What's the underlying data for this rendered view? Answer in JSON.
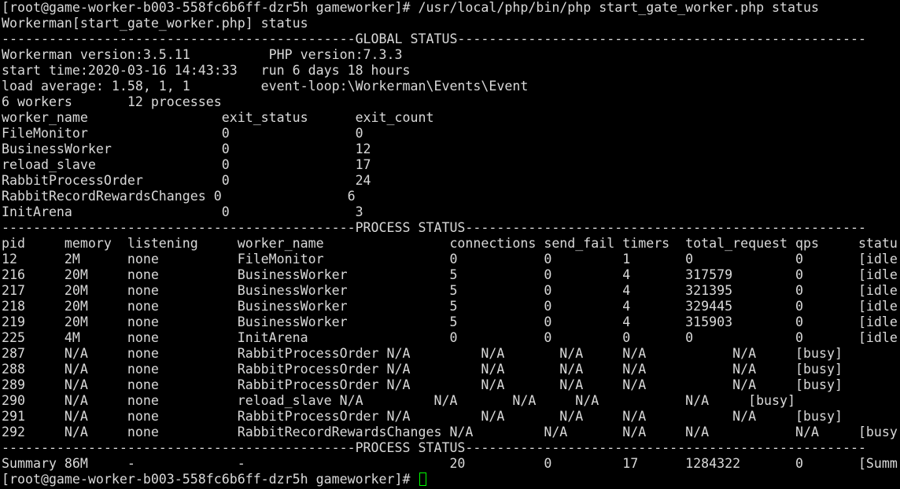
{
  "terminal": {
    "lines": [
      "[root@game-worker-b003-558fc6b6ff-dzr5h gameworker]# /usr/local/php/bin/php start_gate_worker.php status",
      "Workerman[start_gate_worker.php] status",
      "---------------------------------------------GLOBAL STATUS----------------------------------------------------",
      "Workerman version:3.5.11          PHP version:7.3.3",
      "start time:2020-03-16 14:43:33   run 6 days 18 hours",
      "load average: 1.58, 1, 1         event-loop:\\Workerman\\Events\\Event",
      "6 workers       12 processes",
      "worker_name                 exit_status      exit_count",
      "FileMonitor                 0                0",
      "BusinessWorker              0                12",
      "reload_slave                0                17",
      "RabbitProcessOrder          0                24",
      "RabbitRecordRewardsChanges 0                6",
      "InitArena                   0                3",
      "---------------------------------------------PROCESS STATUS---------------------------------------------------",
      "pid     memory  listening     worker_name                connections send_fail timers  total_request qps     status",
      "12      2M      none          FileMonitor                0           0         1       0             0       [idle]",
      "216     20M     none          BusinessWorker             5           0         4       317579        0       [idle]",
      "217     20M     none          BusinessWorker             5           0         4       321395        0       [idle]",
      "218     20M     none          BusinessWorker             5           0         4       329445        0       [idle]",
      "219     20M     none          BusinessWorker             5           0         4       315903        0       [idle]",
      "225     4M      none          InitArena                  0           0         0       0             0       [idle]",
      "287     N/A     none          RabbitProcessOrder N/A         N/A       N/A     N/A           N/A     [busy]",
      "288     N/A     none          RabbitProcessOrder N/A         N/A       N/A     N/A           N/A     [busy]",
      "289     N/A     none          RabbitProcessOrder N/A         N/A       N/A     N/A           N/A     [busy]",
      "290     N/A     none          reload_slave N/A         N/A       N/A     N/A           N/A     [busy]",
      "291     N/A     none          RabbitProcessOrder N/A         N/A       N/A     N/A           N/A     [busy]",
      "292     N/A     none          RabbitRecordRewardsChanges N/A         N/A       N/A     N/A           N/A     [busy]",
      "---------------------------------------------PROCESS STATUS---------------------------------------------------",
      "Summary 86M     -             -                          20          0         17      1284322       0       [Summary]"
    ],
    "prompt": "[root@game-worker-b003-558fc6b6ff-dzr5h gameworker]# ",
    "text_color": "#d9d9d9",
    "cursor_color": "#00ff00",
    "background_color": "#000000"
  }
}
